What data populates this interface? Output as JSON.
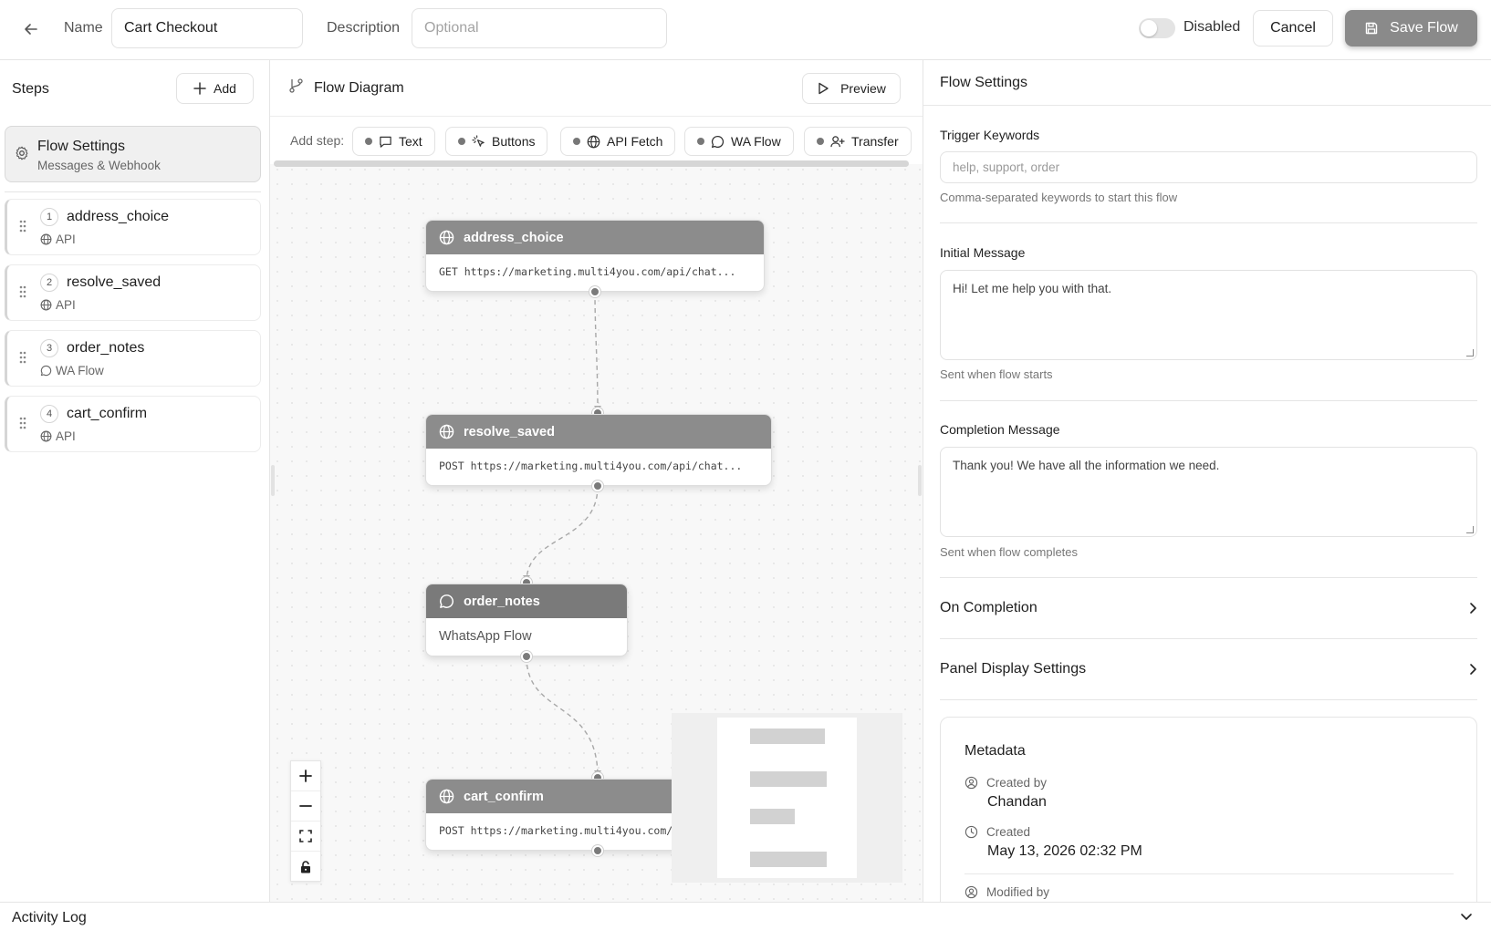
{
  "header": {
    "name_label": "Name",
    "name_value": "Cart Checkout",
    "description_label": "Description",
    "description_placeholder": "Optional",
    "toggle_label": "Disabled",
    "cancel_label": "Cancel",
    "save_label": "Save Flow"
  },
  "steps_panel": {
    "title": "Steps",
    "add_label": "Add",
    "flow_settings": {
      "title": "Flow Settings",
      "subtitle": "Messages & Webhook"
    },
    "items": [
      {
        "num": "1",
        "name": "address_choice",
        "type": "API",
        "icon": "globe-icon"
      },
      {
        "num": "2",
        "name": "resolve_saved",
        "type": "API",
        "icon": "globe-icon"
      },
      {
        "num": "3",
        "name": "order_notes",
        "type": "WA Flow",
        "icon": "chat-icon"
      },
      {
        "num": "4",
        "name": "cart_confirm",
        "type": "API",
        "icon": "globe-icon"
      }
    ]
  },
  "diagram": {
    "title": "Flow Diagram",
    "preview_label": "Preview",
    "add_step_label": "Add step:",
    "chips": [
      {
        "label": "Text",
        "icon": "chat-square-icon"
      },
      {
        "label": "Buttons",
        "icon": "pointer-icon"
      },
      {
        "label": "API Fetch",
        "icon": "globe-icon"
      },
      {
        "label": "WA Flow",
        "icon": "chat-icon"
      },
      {
        "label": "Transfer",
        "icon": "user-plus-icon"
      }
    ],
    "nodes": [
      {
        "title": "address_choice",
        "body": "GET https://marketing.multi4you.com/api/chat..."
      },
      {
        "title": "resolve_saved",
        "body": "POST https://marketing.multi4you.com/api/chat..."
      },
      {
        "title": "order_notes",
        "body": "WhatsApp Flow"
      },
      {
        "title": "cart_confirm",
        "body": "POST https://marketing.multi4you.com/api/chat..."
      }
    ]
  },
  "settings": {
    "title": "Flow Settings",
    "trigger_label": "Trigger Keywords",
    "trigger_placeholder": "help, support, order",
    "trigger_hint": "Comma-separated keywords to start this flow",
    "initial_label": "Initial Message",
    "initial_value": "Hi! Let me help you with that.",
    "initial_hint": "Sent when flow starts",
    "completion_label": "Completion Message",
    "completion_value": "Thank you! We have all the information we need.",
    "completion_hint": "Sent when flow completes",
    "on_completion_label": "On Completion",
    "panel_display_label": "Panel Display Settings",
    "metadata": {
      "title": "Metadata",
      "created_by_label": "Created by",
      "created_by_value": "Chandan",
      "created_label": "Created",
      "created_value": "May 13, 2026 02:32 PM",
      "modified_by_label": "Modified by"
    }
  },
  "footer": {
    "activity_label": "Activity Log"
  }
}
